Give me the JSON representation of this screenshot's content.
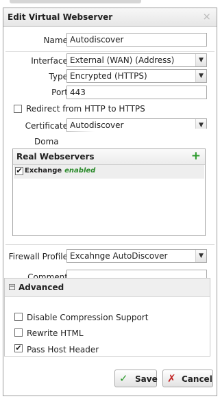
{
  "dialog": {
    "title": "Edit Virtual Webserver",
    "close_glyph": "×"
  },
  "form": {
    "name_label": "Name:",
    "name_value": "Autodiscover",
    "interface_label": "Interface:",
    "interface_value": "External (WAN) (Address)",
    "type_label": "Type:",
    "type_value": "Encrypted (HTTPS)",
    "port_label": "Port:",
    "port_value": "443",
    "redirect_label": "Redirect from HTTP to HTTPS",
    "redirect_checked": false,
    "certificate_label": "Certificate:",
    "certificate_value": "Autodiscover",
    "domains_label": "Doma"
  },
  "real_webservers": {
    "title": "Real Webservers",
    "add_glyph": "+",
    "items": [
      {
        "name": "Exchange",
        "status": "enabled",
        "checked": true
      }
    ]
  },
  "firewall": {
    "label": "Firewall Profile:",
    "value": "Excahnge AutoDiscover"
  },
  "comment": {
    "label": "Comment:",
    "value": ""
  },
  "advanced": {
    "title": "Advanced",
    "collapse_glyph": "−",
    "options": [
      {
        "label": "Disable Compression Support",
        "checked": false
      },
      {
        "label": "Rewrite HTML",
        "checked": false
      },
      {
        "label": "Pass Host Header",
        "checked": true
      }
    ]
  },
  "buttons": {
    "save_label": "Save",
    "save_icon": "check-icon",
    "cancel_label": "Cancel",
    "cancel_icon": "x-icon"
  },
  "colors": {
    "accent_green": "#2a9a2a",
    "cancel_red": "#c02020"
  },
  "glyphs": {
    "select_arrow": "▼",
    "check": "✔",
    "checkmark": "✓",
    "cross": "✗"
  }
}
